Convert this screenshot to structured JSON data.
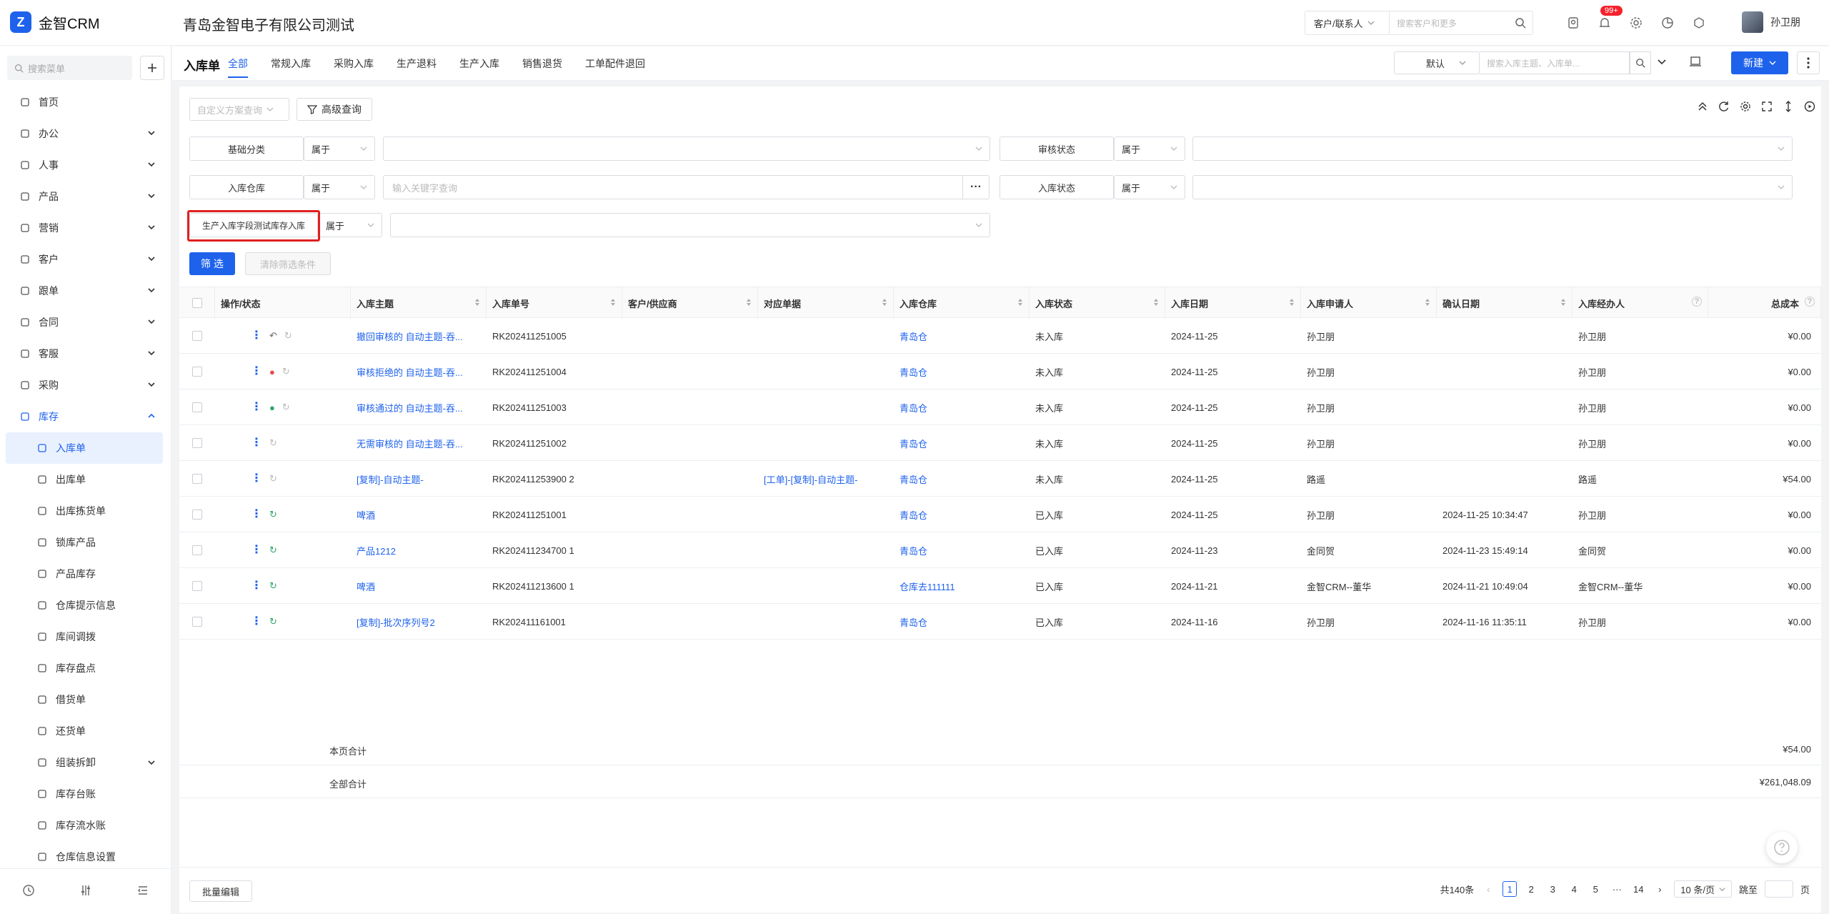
{
  "app": {
    "logo_text": "金智CRM",
    "company": "青岛金智电子有限公司测试",
    "accent": "#1e62ec"
  },
  "header": {
    "search_scope": "客户/联系人",
    "search_placeholder": "搜索客户和更多",
    "notification_badge": "99+",
    "user_name": "孙卫朋"
  },
  "sidebar": {
    "search_placeholder": "搜索菜单",
    "items": [
      {
        "label": "首页",
        "icon": "home-icon",
        "chev": false
      },
      {
        "label": "办公",
        "icon": "office-icon",
        "chev": true
      },
      {
        "label": "人事",
        "icon": "hr-icon",
        "chev": true
      },
      {
        "label": "产品",
        "icon": "product-icon",
        "chev": true
      },
      {
        "label": "营销",
        "icon": "marketing-icon",
        "chev": true
      },
      {
        "label": "客户",
        "icon": "customer-icon",
        "chev": true
      },
      {
        "label": "跟单",
        "icon": "followup-icon",
        "chev": true
      },
      {
        "label": "合同",
        "icon": "contract-icon",
        "chev": true
      },
      {
        "label": "客服",
        "icon": "service-icon",
        "chev": true
      },
      {
        "label": "采购",
        "icon": "purchase-icon",
        "chev": true
      },
      {
        "label": "库存",
        "icon": "inventory-icon",
        "chev": true
      }
    ],
    "subitems": [
      {
        "label": "入库单",
        "active": true
      },
      {
        "label": "出库单"
      },
      {
        "label": "出库拣货单"
      },
      {
        "label": "锁库产品"
      },
      {
        "label": "产品库存"
      },
      {
        "label": "仓库提示信息"
      },
      {
        "label": "库间调拨"
      },
      {
        "label": "库存盘点"
      },
      {
        "label": "借货单"
      },
      {
        "label": "还货单"
      },
      {
        "label": "组装拆卸",
        "chev": true
      },
      {
        "label": "库存台账"
      },
      {
        "label": "库存流水账"
      },
      {
        "label": "仓库信息设置"
      }
    ]
  },
  "page": {
    "title": "入库单",
    "tabs": [
      "全部",
      "常规入库",
      "采购入库",
      "生产退料",
      "生产入库",
      "销售退货",
      "工单配件退回"
    ],
    "view": "默认",
    "search_placeholder": "搜索入库主题、入库单...",
    "new_label": "新建"
  },
  "filters": {
    "scheme_placeholder": "自定义方案查询",
    "advanced_label": "高级查询",
    "rows": [
      {
        "label": "基础分类",
        "op": "属于",
        "value": ""
      },
      {
        "label": "审核状态",
        "op": "属于",
        "value": ""
      },
      {
        "label": "入库仓库",
        "op": "属于",
        "value": "输入关键字查询"
      },
      {
        "label": "入库状态",
        "op": "属于",
        "value": ""
      },
      {
        "label": "生产入库字段测试库存入库",
        "op": "属于",
        "value": ""
      }
    ],
    "filter_btn": "筛 选",
    "clear_btn": "清除筛选条件"
  },
  "table": {
    "columns": [
      "操作/状态",
      "入库主题",
      "入库单号",
      "客户/供应商",
      "对应单据",
      "入库仓库",
      "入库状态",
      "入库日期",
      "入库申请人",
      "确认日期",
      "入库经办人",
      "总成本"
    ],
    "rows": [
      {
        "subject": "撤回审核的 自动主题-吞...",
        "no": "RK202411251005",
        "supplier": "",
        "ref": "",
        "warehouse": "青岛仓",
        "status": "未入库",
        "date": "2024-11-25",
        "applicant": "孙卫朋",
        "confirm": "",
        "handler": "孙卫朋",
        "cost": "¥0.00",
        "icon": "undo-icon"
      },
      {
        "subject": "审核拒绝的 自动主题-吞...",
        "no": "RK202411251004",
        "supplier": "",
        "ref": "",
        "warehouse": "青岛仓",
        "status": "未入库",
        "date": "2024-11-25",
        "applicant": "孙卫朋",
        "confirm": "",
        "handler": "孙卫朋",
        "cost": "¥0.00",
        "icon": "user-rejected-icon"
      },
      {
        "subject": "审核通过的 自动主题-吞...",
        "no": "RK202411251003",
        "supplier": "",
        "ref": "",
        "warehouse": "青岛仓",
        "status": "未入库",
        "date": "2024-11-25",
        "applicant": "孙卫朋",
        "confirm": "",
        "handler": "孙卫朋",
        "cost": "¥0.00",
        "icon": "user-approved-icon"
      },
      {
        "subject": "无需审核的 自动主题-吞...",
        "no": "RK202411251002",
        "supplier": "",
        "ref": "",
        "warehouse": "青岛仓",
        "status": "未入库",
        "date": "2024-11-25",
        "applicant": "孙卫朋",
        "confirm": "",
        "handler": "孙卫朋",
        "cost": "¥0.00",
        "icon": ""
      },
      {
        "subject": "[复制]-自动主题-",
        "no": "RK202411253900 2",
        "supplier": "",
        "ref": "[工单]-[复制]-自动主题-",
        "warehouse": "青岛仓",
        "status": "未入库",
        "date": "2024-11-25",
        "applicant": "路遥",
        "confirm": "",
        "handler": "路遥",
        "cost": "¥54.00",
        "icon": ""
      },
      {
        "subject": "啤酒",
        "no": "RK202411251001",
        "supplier": "",
        "ref": "",
        "warehouse": "青岛仓",
        "status": "已入库",
        "date": "2024-11-25",
        "applicant": "孙卫朋",
        "confirm": "2024-11-25 10:34:47",
        "handler": "孙卫朋",
        "cost": "¥0.00",
        "icon": ""
      },
      {
        "subject": "产品1212",
        "no": "RK202411234700 1",
        "supplier": "",
        "ref": "",
        "warehouse": "青岛仓",
        "status": "已入库",
        "date": "2024-11-23",
        "applicant": "金同贺",
        "confirm": "2024-11-23 15:49:14",
        "handler": "金同贺",
        "cost": "¥0.00",
        "icon": ""
      },
      {
        "subject": "啤酒",
        "no": "RK202411213600 1",
        "supplier": "",
        "ref": "",
        "warehouse": "仓库去111111",
        "status": "已入库",
        "date": "2024-11-21",
        "applicant": "金智CRM--董华",
        "confirm": "2024-11-21 10:49:04",
        "handler": "金智CRM--董华",
        "cost": "¥0.00",
        "icon": ""
      },
      {
        "subject": "[复制]-批次序列号2",
        "no": "RK202411161001",
        "supplier": "",
        "ref": "",
        "warehouse": "青岛仓",
        "status": "已入库",
        "date": "2024-11-16",
        "applicant": "孙卫朋",
        "confirm": "2024-11-16 11:35:11",
        "handler": "孙卫朋",
        "cost": "¥0.00",
        "icon": ""
      }
    ],
    "page_total_label": "本页合计",
    "page_total": "¥54.00",
    "all_total_label": "全部合计",
    "all_total": "¥261,048.09"
  },
  "footer": {
    "bulk_edit": "批量编辑",
    "total": "共140条",
    "pages": [
      "1",
      "2",
      "3",
      "4",
      "5",
      "···",
      "14"
    ],
    "page_size": "10 条/页",
    "jump_label": "跳至",
    "page_unit": "页"
  }
}
